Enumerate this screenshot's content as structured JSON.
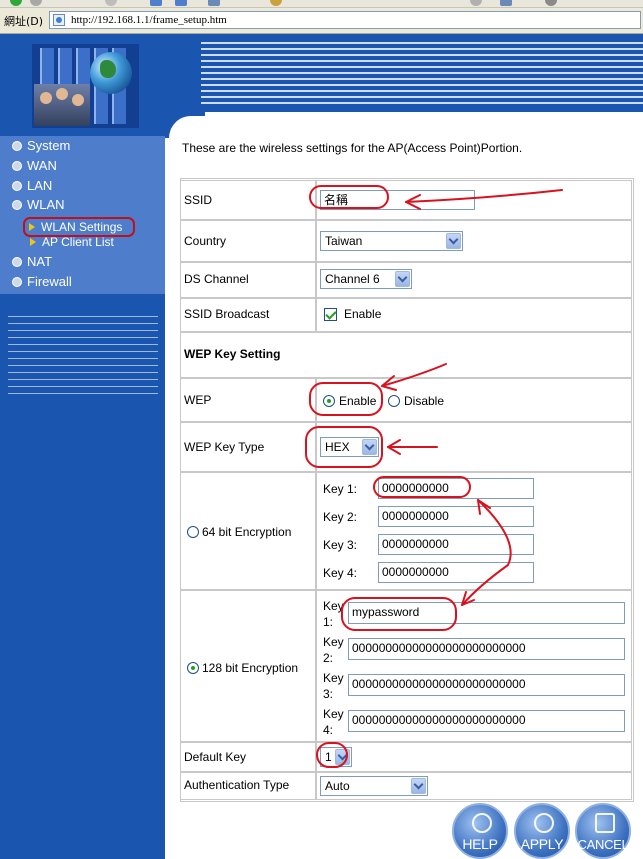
{
  "browser": {
    "address_label": "網址(D)",
    "url": "http://192.168.1.1/frame_setup.htm"
  },
  "sidebar": {
    "items": [
      {
        "label": "System"
      },
      {
        "label": "WAN"
      },
      {
        "label": "LAN"
      },
      {
        "label": "WLAN"
      },
      {
        "label": "NAT"
      },
      {
        "label": "Firewall"
      }
    ],
    "wlan_subitems": [
      {
        "label": "WLAN Settings"
      },
      {
        "label": "AP Client List"
      }
    ]
  },
  "intro_text": "These are the wireless settings for the AP(Access Point)Portion.",
  "settings": {
    "ssid": {
      "label": "SSID",
      "value": "名稱"
    },
    "country": {
      "label": "Country",
      "value": "Taiwan"
    },
    "ds_channel": {
      "label": "DS Channel",
      "value": "Channel 6"
    },
    "ssid_broadcast": {
      "label": "SSID Broadcast",
      "option": "Enable"
    },
    "wep_key_setting_heading": "WEP Key Setting",
    "wep": {
      "label": "WEP",
      "enable": "Enable",
      "disable": "Disable"
    },
    "wep_key_type": {
      "label": "WEP Key Type",
      "value": "HEX"
    },
    "enc64": {
      "label": "64 bit Encryption",
      "keys": [
        {
          "label": "Key 1:",
          "value": "0000000000"
        },
        {
          "label": "Key 2:",
          "value": "0000000000"
        },
        {
          "label": "Key 3:",
          "value": "0000000000"
        },
        {
          "label": "Key 4:",
          "value": "0000000000"
        }
      ]
    },
    "enc128": {
      "label": "128 bit Encryption",
      "keys": [
        {
          "label_top": "Key",
          "label_bottom": "1:",
          "value": "mypassword"
        },
        {
          "label_top": "Key",
          "label_bottom": "2:",
          "value": "00000000000000000000000000"
        },
        {
          "label_top": "Key",
          "label_bottom": "3:",
          "value": "00000000000000000000000000"
        },
        {
          "label_top": "Key",
          "label_bottom": "4:",
          "value": "00000000000000000000000000"
        }
      ]
    },
    "default_key": {
      "label": "Default Key",
      "value": "1"
    },
    "auth_type": {
      "label": "Authentication Type",
      "value": "Auto"
    }
  },
  "buttons": {
    "help": "HELP",
    "apply": "APPLY",
    "cancel": "CANCEL"
  },
  "colors": {
    "sidebar_dark": "#1a56b0",
    "sidebar_light": "#4e7ecb",
    "annotation_red": "#d8121e",
    "highlight_yellow": "#f2c30f"
  },
  "icons": {
    "help_button": "question-icon",
    "apply_button": "apply-icon",
    "cancel_button": "trash-icon"
  }
}
